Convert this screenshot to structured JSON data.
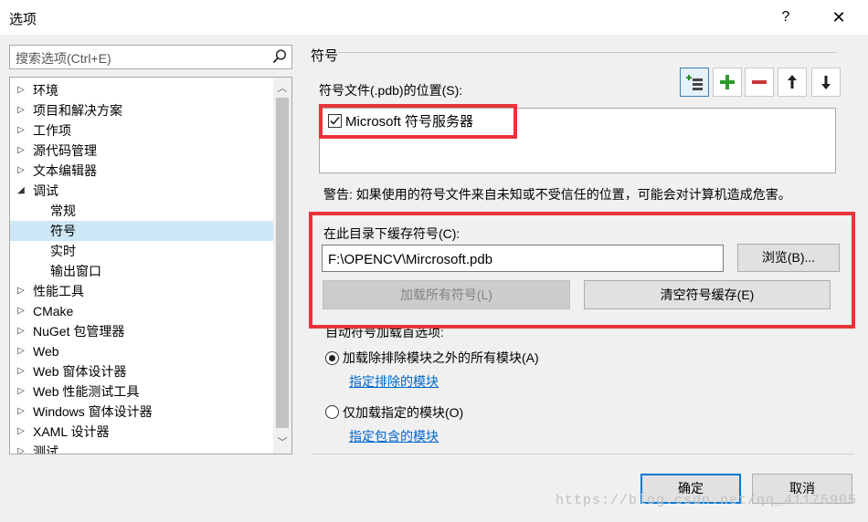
{
  "window": {
    "title": "选项",
    "help_icon": "?",
    "close_icon": "✕"
  },
  "search": {
    "placeholder": "搜索选项(Ctrl+E)"
  },
  "tree": {
    "items": [
      {
        "label": "环境",
        "arrow": "▷"
      },
      {
        "label": "项目和解决方案",
        "arrow": "▷"
      },
      {
        "label": "工作项",
        "arrow": "▷"
      },
      {
        "label": "源代码管理",
        "arrow": "▷"
      },
      {
        "label": "文本编辑器",
        "arrow": "▷"
      },
      {
        "label": "调试",
        "arrow": "◢"
      },
      {
        "label": "常规",
        "arrow": ""
      },
      {
        "label": "符号",
        "arrow": "",
        "selected": true
      },
      {
        "label": "实时",
        "arrow": ""
      },
      {
        "label": "输出窗口",
        "arrow": ""
      },
      {
        "label": "性能工具",
        "arrow": "▷"
      },
      {
        "label": "CMake",
        "arrow": "▷"
      },
      {
        "label": "NuGet 包管理器",
        "arrow": "▷"
      },
      {
        "label": "Web",
        "arrow": "▷"
      },
      {
        "label": "Web 窗体设计器",
        "arrow": "▷"
      },
      {
        "label": "Web 性能测试工具",
        "arrow": "▷"
      },
      {
        "label": "Windows 窗体设计器",
        "arrow": "▷"
      },
      {
        "label": "XAML 设计器",
        "arrow": "▷"
      },
      {
        "label": "测试",
        "arrow": "▷"
      }
    ]
  },
  "section": {
    "title": "符号",
    "locations_label": "符号文件(.pdb)的位置(S):",
    "toolbar": [
      "add-symbol-server-icon",
      "plus-icon",
      "minus-icon",
      "arrow-up-icon",
      "arrow-down-icon"
    ],
    "list_item": {
      "label": "Microsoft 符号服务器",
      "checked": true
    },
    "warning": "警告: 如果使用的符号文件来自未知或不受信任的位置，可能会对计算机造成危害。",
    "cache_label": "在此目录下缓存符号(C):",
    "cache_path": "F:\\OPENCV\\Mircrosoft.pdb",
    "browse": "浏览(B)...",
    "load_all": "加载所有符号(L)",
    "clear_cache": "清空符号缓存(E)",
    "auto_load_label": "自动符号加载首选项:",
    "radio1": {
      "label": "加载除排除模块之外的所有模块(A)",
      "selected": true
    },
    "link1": "指定排除的模块",
    "radio2": {
      "label": "仅加载指定的模块(O)",
      "selected": false
    },
    "link2": "指定包含的模块"
  },
  "footer": {
    "ok": "确定",
    "cancel": "取消"
  },
  "watermark": "https://blog.csdn.net/qq_41175905",
  "colors": {
    "highlight": "#e8343a",
    "selected": "#cde8f6",
    "link": "#0066cc",
    "primary": "#0078d7"
  }
}
